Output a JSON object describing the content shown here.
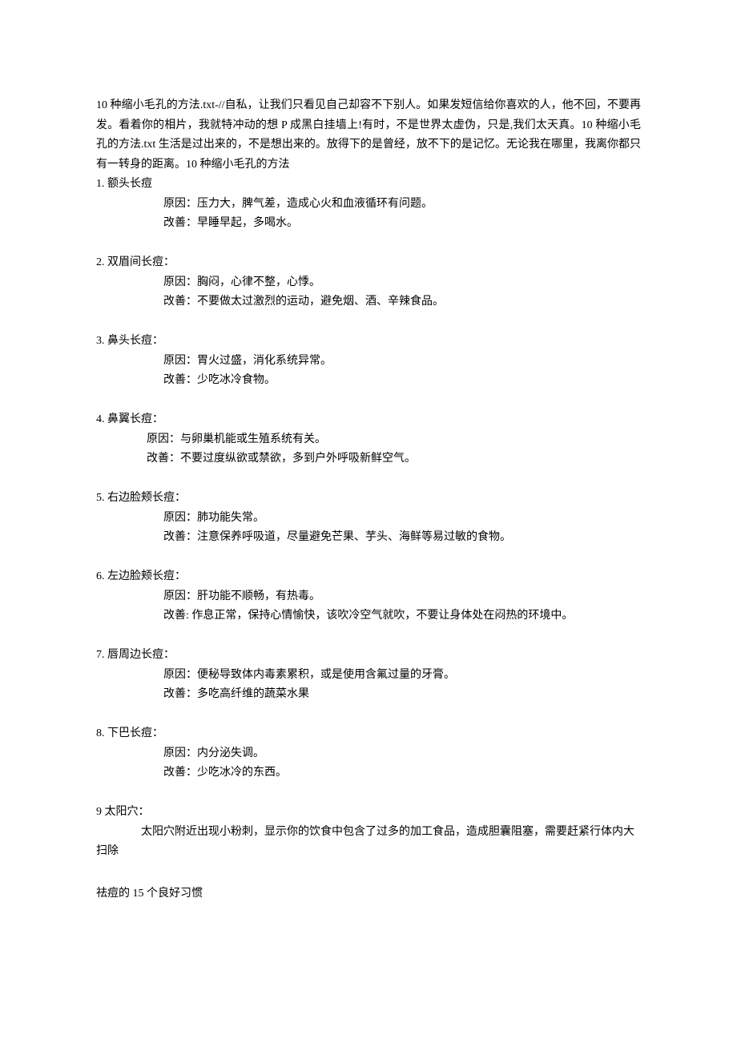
{
  "intro": "10 种缩小毛孔的方法.txt-//自私，让我们只看见自己却容不下别人。如果发短信给你喜欢的人，他不回，不要再发。看着你的相片，我就特冲动的想 P 成黑白挂墙上!有时，不是世界太虚伪，只是,我们太天真。10 种缩小毛孔的方法.txt 生活是过出来的，不是想出来的。放得下的是曾经，放不下的是记忆。无论我在哪里，我离你都只有一转身的距离。10 种缩小毛孔的方法",
  "items": [
    {
      "header": "1.  额头长痘",
      "lines": [
        "原因：压力大，脾气差，造成心火和血液循环有问题。",
        "改善：早睡早起，多喝水。"
      ],
      "indent": "sub"
    },
    {
      "header": "2.   双眉间长痘：",
      "lines": [
        "原因：胸闷，心律不整，心悸。",
        "改善：不要做太过激烈的运动，避免烟、酒、辛辣食品。"
      ],
      "indent": "sub"
    },
    {
      "header": "3.   鼻头长痘：",
      "lines": [
        "原因：胃火过盛，消化系统异常。",
        "改善：少吃冰冷食物。"
      ],
      "indent": "sub"
    },
    {
      "header": "4.   鼻翼长痘：",
      "lines": [
        "原因：与卵巢机能或生殖系统有关。",
        "改善：不要过度纵欲或禁欲，多到户外呼吸新鲜空气。"
      ],
      "indent": "sub2"
    },
    {
      "header": "5.   右边脸颊长痘：",
      "lines": [
        "原因：肺功能失常。",
        "改善：注意保养呼吸道，尽量避免芒果、芋头、海鲜等易过敏的食物。"
      ],
      "indent": "sub"
    },
    {
      "header": "6.   左边脸颊长痘：",
      "lines": [
        "原因：肝功能不顺畅，有热毒。",
        "改善: 作息正常，保持心情愉快，该吹冷空气就吹，不要让身体处在闷热的环境中。"
      ],
      "indent": "sub"
    },
    {
      "header": "7.   唇周边长痘：",
      "lines": [
        "原因：便秘导致体内毒素累积，或是使用含氟过量的牙膏。",
        "改善：多吃高纤维的蔬菜水果"
      ],
      "indent": "sub"
    },
    {
      "header": "8.   下巴长痘：",
      "lines": [
        "原因：内分泌失调。",
        "改善：少吃冰冷的东西。"
      ],
      "indent": "sub"
    }
  ],
  "item9": {
    "header": "9  太阳穴：",
    "body": "　　　　太阳穴附近出现小粉刺，显示你的饮食中包含了过多的加工食品，造成胆囊阻塞，需要赶紧行体内大扫除"
  },
  "footer": "祛痘的 15 个良好习惯"
}
